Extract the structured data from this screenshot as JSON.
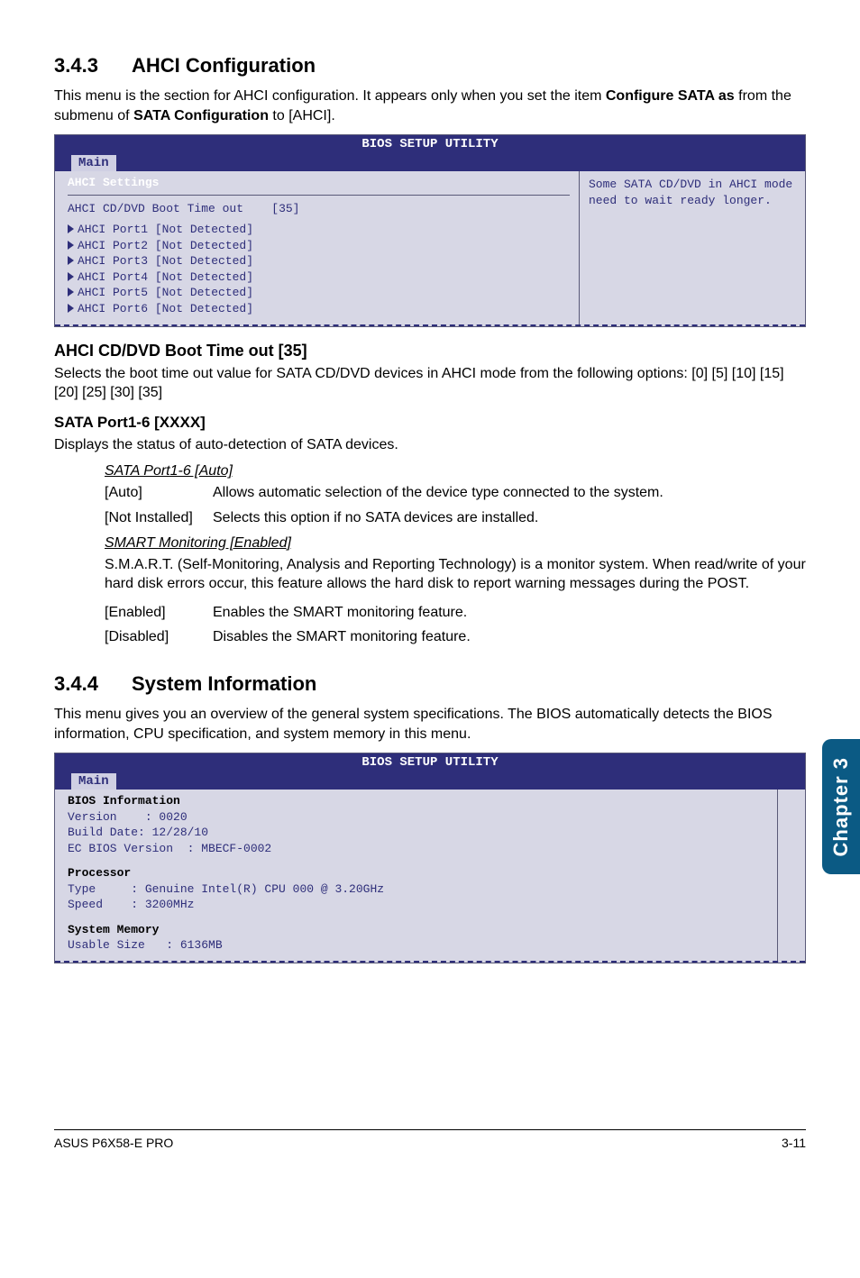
{
  "side_tab": "Chapter 3",
  "section_343": {
    "num": "3.4.3",
    "title": "AHCI Configuration",
    "intro_pre": "This menu is the section for AHCI configuration. It appears only when you set the item ",
    "intro_bold1": "Configure SATA as",
    "intro_mid": " from the submenu of ",
    "intro_bold2": "SATA Configuration",
    "intro_post": " to [AHCI]."
  },
  "bios1": {
    "title": "BIOS SETUP UTILITY",
    "tab": "Main",
    "heading": "AHCI Settings",
    "boot_label": "AHCI CD/DVD Boot Time out",
    "boot_value": "[35]",
    "ports": [
      "AHCI Port1 [Not Detected]",
      "AHCI Port2 [Not Detected]",
      "AHCI Port3 [Not Detected]",
      "AHCI Port4 [Not Detected]",
      "AHCI Port5 [Not Detected]",
      "AHCI Port6 [Not Detected]"
    ],
    "help": "Some SATA CD/DVD in AHCI mode need to wait ready longer."
  },
  "opt_boot": {
    "title": "AHCI CD/DVD Boot Time out [35]",
    "desc": "Selects the boot time out value for SATA CD/DVD devices in AHCI mode from the following options: [0] [5] [10] [15] [20] [25] [30] [35]"
  },
  "opt_sata": {
    "title": "SATA Port1-6 [XXXX]",
    "desc": "Displays the status of auto-detection of SATA devices.",
    "sub1_label": "SATA Port1-6 [Auto]",
    "rows1": [
      {
        "k": "[Auto]",
        "v": "Allows automatic selection of the device type connected to the system."
      },
      {
        "k": "[Not Installed]",
        "v": "Selects this option if no SATA devices are installed."
      }
    ],
    "sub2_label": "SMART Monitoring [Enabled]",
    "sub2_desc": "S.M.A.R.T. (Self-Monitoring, Analysis and Reporting Technology) is a monitor system. When read/write of your hard disk errors occur, this feature allows the hard disk to report warning messages during the POST.",
    "rows2": [
      {
        "k": "[Enabled]",
        "v": "Enables the SMART monitoring feature."
      },
      {
        "k": "[Disabled]",
        "v": "Disables the SMART monitoring feature."
      }
    ]
  },
  "section_344": {
    "num": "3.4.4",
    "title": "System Information",
    "intro": "This menu gives you an overview of the general system specifications. The BIOS automatically detects the BIOS information, CPU specification, and system memory in this menu."
  },
  "bios2": {
    "title": "BIOS SETUP UTILITY",
    "tab": "Main",
    "h_bios": "BIOS Information",
    "l_version": "Version    : 0020",
    "l_build": "Build Date: 12/28/10",
    "l_ec": "EC BIOS Version  : MBECF-0002",
    "h_proc": "Processor",
    "l_type": "Type     : Genuine Intel(R) CPU 000 @ 3.20GHz",
    "l_speed": "Speed    : 3200MHz",
    "h_mem": "System Memory",
    "l_usable": "Usable Size   : 6136MB"
  },
  "footer": {
    "left": "ASUS P6X58-E PRO",
    "right": "3-11"
  }
}
